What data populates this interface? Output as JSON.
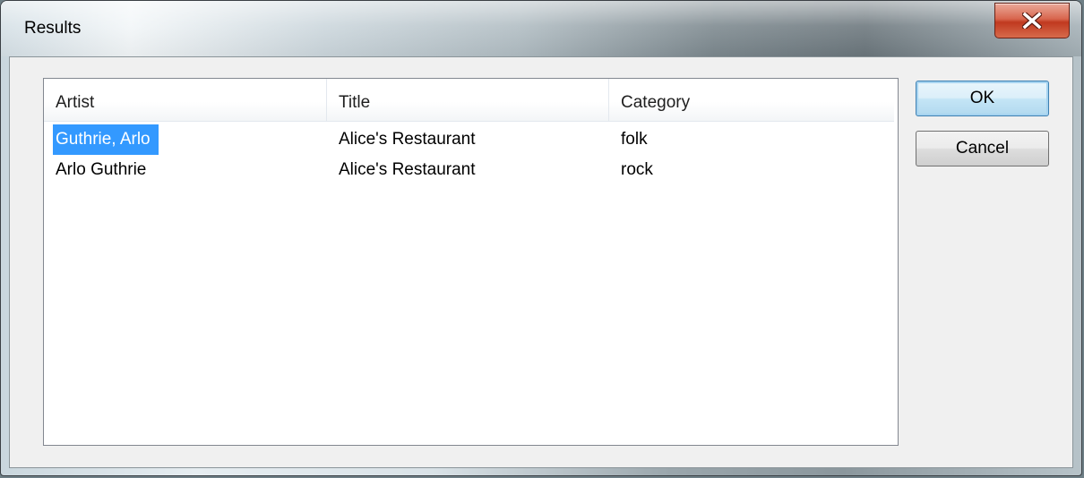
{
  "window": {
    "title": "Results"
  },
  "listview": {
    "columns": [
      "Artist",
      "Title",
      "Category"
    ],
    "rows": [
      {
        "artist": "Guthrie, Arlo",
        "title": "Alice's Restaurant",
        "category": "folk",
        "selected": true
      },
      {
        "artist": "Arlo Guthrie",
        "title": "Alice's Restaurant",
        "category": "rock",
        "selected": false
      }
    ]
  },
  "buttons": {
    "ok_label": "OK",
    "cancel_label": "Cancel"
  },
  "icons": {
    "close": "close-icon"
  },
  "colors": {
    "selection": "#3399ff",
    "close_button": "#c0391f"
  }
}
